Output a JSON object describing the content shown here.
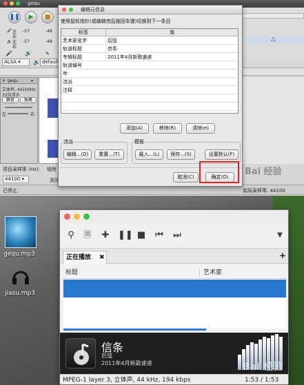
{
  "audacity": {
    "title": "gequ",
    "track_info": {
      "name": "gequ",
      "format": "立体声, 44100Hz",
      "bit_depth": "32位浮点",
      "mute": "静音",
      "solo": "独奏",
      "channel_l": "左",
      "channel_r": "右"
    },
    "meters": {
      "left_a": "左",
      "right_a": "右",
      "db1": "-57",
      "db2": "-48",
      "db3": "-57",
      "db4": "-48"
    },
    "device": {
      "host": "ALSA",
      "output": "default"
    },
    "project_rate_label": "项目采样率 (Hz):",
    "project_rate_value": "44100",
    "snap_label": "吸附",
    "close_label": "关闭",
    "status_left": "已停止.",
    "status_right": "实际采样率: 44100"
  },
  "dialog": {
    "title": "编辑元信息",
    "instruction": "使用鼠标指针(或编辑完后按回车键)切换到下一条目",
    "col_tag": "标签",
    "col_value": "值",
    "rows": [
      {
        "tag": "艺术家名字",
        "value": "后弦"
      },
      {
        "tag": "轨道标题",
        "value": "信条"
      },
      {
        "tag": "专辑标题",
        "value": "2011年4月新歌速递"
      },
      {
        "tag": "轨道编号",
        "value": ""
      },
      {
        "tag": "年",
        "value": ""
      },
      {
        "tag": "流派",
        "value": ""
      },
      {
        "tag": "注释",
        "value": ""
      }
    ],
    "add": "添加(A)",
    "remove": "移除(R)",
    "clear": "清除(e)",
    "genre_group": "流派",
    "genre_edit": "编辑...(D)",
    "genre_reset": "重置...(T)",
    "template_group": "模板",
    "load": "载入...(L)",
    "save": "保存...(S)",
    "set_default": "设置默认(F)",
    "cancel": "取消(C)",
    "ok": "确定(O)"
  },
  "desktop": {
    "icons": [
      {
        "label": "gequ.mp3",
        "icon": "music-file-icon"
      },
      {
        "label": "jiasu.mp3",
        "icon": "headphones-file-icon"
      }
    ]
  },
  "player": {
    "tab_label": "正在播放",
    "col_title": "标题",
    "col_artist": "艺术家",
    "now_title": "信条",
    "now_artist": "后弦",
    "now_album": "2011年4月新歌速递",
    "status_left": "MPEG-1 layer 3, 立体声, 44 kHz, 194 kbps",
    "status_right": "1:53 / 1:53",
    "progress": 0.64
  },
  "watermark": "Bai 经验",
  "colors": {
    "selection_blue": "#2a78d2",
    "highlight_red": "#e2231a",
    "mac_red": "#fc605c",
    "mac_yellow": "#fdbc40",
    "mac_green": "#34c84a"
  }
}
